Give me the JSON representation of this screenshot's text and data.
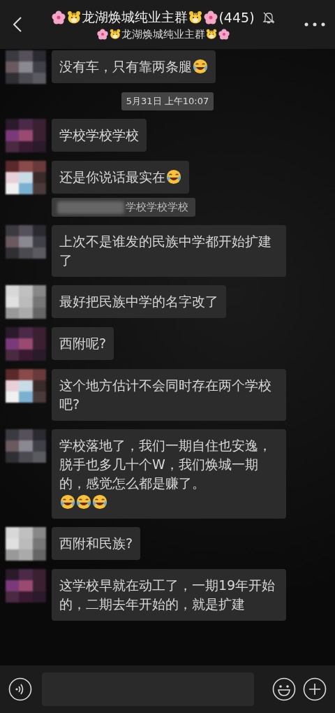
{
  "header": {
    "title": [
      {
        "kind": "flower"
      },
      {
        "kind": "tiger"
      },
      {
        "kind": "text",
        "text": "龙湖焕城纯业主群"
      },
      {
        "kind": "tiger"
      },
      {
        "kind": "flower"
      },
      {
        "kind": "text",
        "text": "(445)"
      }
    ],
    "muted": true,
    "subtitle": [
      {
        "kind": "flower"
      },
      {
        "kind": "tiger"
      },
      {
        "kind": "text",
        "text": "龙湖焕城纯业主群"
      },
      {
        "kind": "tiger"
      },
      {
        "kind": "flower"
      }
    ]
  },
  "messages": [
    {
      "kind": "bubble",
      "parts": [
        {
          "kind": "text",
          "text": "没有车，只有靠两条腿"
        },
        {
          "kind": "laugh"
        }
      ]
    },
    {
      "kind": "time",
      "text": "5月31日 上午10:07"
    },
    {
      "kind": "bubble",
      "parts": [
        {
          "kind": "text",
          "text": "学校学校学校"
        }
      ]
    },
    {
      "kind": "bubble",
      "parts": [
        {
          "kind": "text",
          "text": "还是你说话最实在"
        },
        {
          "kind": "laugh"
        }
      ],
      "quote": "学校学校学校"
    },
    {
      "kind": "bubble",
      "parts": [
        {
          "kind": "text",
          "text": "上次不是谁发的民族中学都开始扩建了"
        }
      ]
    },
    {
      "kind": "bubble",
      "parts": [
        {
          "kind": "text",
          "text": "最好把民族中学的名字改了"
        }
      ]
    },
    {
      "kind": "bubble",
      "parts": [
        {
          "kind": "text",
          "text": "西附呢?"
        }
      ]
    },
    {
      "kind": "bubble",
      "parts": [
        {
          "kind": "text",
          "text": "这个地方估计不会同时存在两个学校吧?"
        }
      ]
    },
    {
      "kind": "bubble",
      "parts": [
        {
          "kind": "text",
          "text": "学校落地了，我们一期自住也安逸，脱手也多几十个W，我们焕城一期的，感觉怎么都是赚了。"
        },
        {
          "kind": "laugh"
        },
        {
          "kind": "laugh"
        },
        {
          "kind": "laugh"
        }
      ]
    },
    {
      "kind": "bubble",
      "parts": [
        {
          "kind": "text",
          "text": "西附和民族?"
        }
      ]
    },
    {
      "kind": "bubble",
      "parts": [
        {
          "kind": "text",
          "text": "这学校早就在动工了，一期19年开始的，二期去年开始的，就是扩建"
        }
      ]
    }
  ]
}
